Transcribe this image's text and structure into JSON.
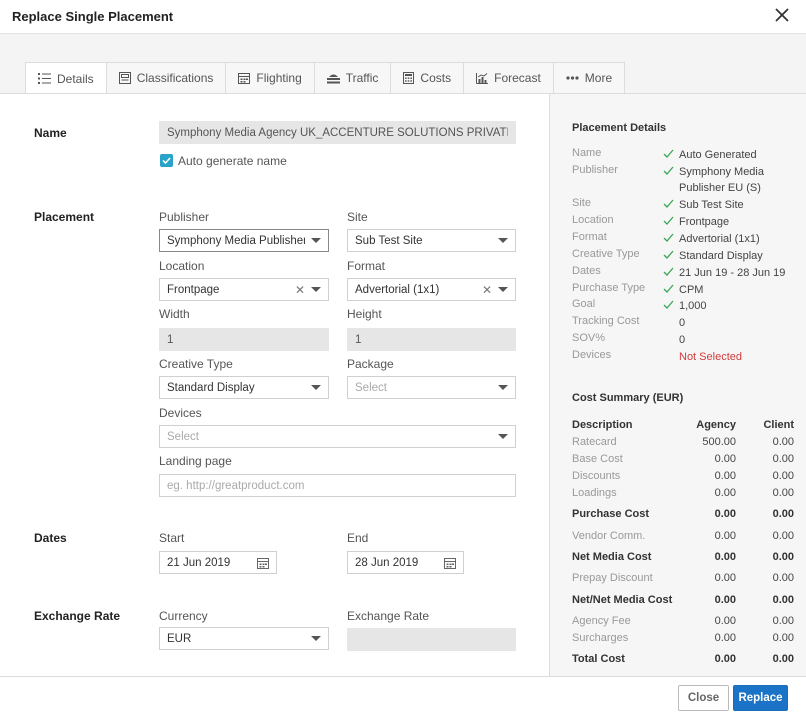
{
  "dialog": {
    "title": "Replace Single Placement"
  },
  "tabs": [
    {
      "label": "Details",
      "icon": "list-icon",
      "active": true
    },
    {
      "label": "Classifications",
      "icon": "classifications-icon"
    },
    {
      "label": "Flighting",
      "icon": "calendar-icon"
    },
    {
      "label": "Traffic",
      "icon": "traffic-icon"
    },
    {
      "label": "Costs",
      "icon": "calculator-icon"
    },
    {
      "label": "Forecast",
      "icon": "forecast-chart-icon"
    },
    {
      "label": "More",
      "icon": "more-dots-icon"
    }
  ],
  "name_section": {
    "label": "Name",
    "value": "Symphony Media Agency UK_ACCENTURE SOLUTIONS PRIVATE LIMITE",
    "auto_generate_label": "Auto generate name",
    "auto_generate_checked": true
  },
  "placement": {
    "label": "Placement",
    "publisher_label": "Publisher",
    "publisher_value": "Symphony Media Publisher EU (S)",
    "site_label": "Site",
    "site_value": "Sub Test Site",
    "location_label": "Location",
    "location_value": "Frontpage",
    "format_label": "Format",
    "format_value": "Advertorial (1x1)",
    "width_label": "Width",
    "width_value": "1",
    "height_label": "Height",
    "height_value": "1",
    "creative_type_label": "Creative Type",
    "creative_type_value": "Standard Display",
    "package_label": "Package",
    "package_placeholder": "Select",
    "devices_label": "Devices",
    "devices_placeholder": "Select",
    "landing_page_label": "Landing page",
    "landing_page_placeholder": "eg. http://greatproduct.com"
  },
  "dates": {
    "label": "Dates",
    "start_label": "Start",
    "start_value": "21 Jun 2019",
    "end_label": "End",
    "end_value": "28 Jun 2019"
  },
  "exchange": {
    "label": "Exchange Rate",
    "currency_label": "Currency",
    "currency_value": "EUR",
    "rate_label": "Exchange Rate",
    "rate_value": ""
  },
  "placement_details": {
    "title": "Placement Details",
    "rows": [
      {
        "key": "Name",
        "value": "Auto Generated",
        "tick": true
      },
      {
        "key": "Publisher",
        "value": "Symphony Media Publisher EU (S)",
        "tick": true
      },
      {
        "key": "Site",
        "value": "Sub Test Site",
        "tick": true
      },
      {
        "key": "Location",
        "value": "Frontpage",
        "tick": true
      },
      {
        "key": "Format",
        "value": "Advertorial (1x1)",
        "tick": true
      },
      {
        "key": "Creative Type",
        "value": "Standard Display",
        "tick": true
      },
      {
        "key": "Dates",
        "value": "21 Jun 19 - 28 Jun 19",
        "tick": true
      },
      {
        "key": "Purchase Type",
        "value": "CPM",
        "tick": true
      },
      {
        "key": "Goal",
        "value": "1,000",
        "tick": true
      },
      {
        "key": "Tracking Cost",
        "value": "0",
        "tick": false
      },
      {
        "key": "SOV%",
        "value": "0",
        "tick": false
      },
      {
        "key": "Devices",
        "value": "Not Selected",
        "tick": false,
        "warn": true
      }
    ]
  },
  "cost_summary": {
    "title": "Cost Summary (EUR)",
    "headers": {
      "description": "Description",
      "agency": "Agency",
      "client": "Client"
    },
    "rows": [
      {
        "label": "Ratecard",
        "agency": "500.00",
        "client": "0.00",
        "bold": false
      },
      {
        "label": "Base Cost",
        "agency": "0.00",
        "client": "0.00",
        "bold": false
      },
      {
        "label": "Discounts",
        "agency": "0.00",
        "client": "0.00",
        "bold": false
      },
      {
        "label": "Loadings",
        "agency": "0.00",
        "client": "0.00",
        "bold": false
      },
      {
        "label": "Purchase Cost",
        "agency": "0.00",
        "client": "0.00",
        "bold": true
      },
      {
        "label": "Vendor Comm.",
        "agency": "0.00",
        "client": "0.00",
        "bold": false
      },
      {
        "label": "Net Media Cost",
        "agency": "0.00",
        "client": "0.00",
        "bold": true
      },
      {
        "label": "Prepay Discount",
        "agency": "0.00",
        "client": "0.00",
        "bold": false
      },
      {
        "label": "Net/Net Media Cost",
        "agency": "0.00",
        "client": "0.00",
        "bold": true
      },
      {
        "label": "Agency Fee",
        "agency": "0.00",
        "client": "0.00",
        "bold": false
      },
      {
        "label": "Surcharges",
        "agency": "0.00",
        "client": "0.00",
        "bold": false
      },
      {
        "label": "Total Cost",
        "agency": "0.00",
        "client": "0.00",
        "bold": true
      }
    ]
  },
  "footer": {
    "close_label": "Close",
    "replace_label": "Replace"
  },
  "colors": {
    "primary": "#1a73c6",
    "check": "#29a3c9",
    "tick": "#3aa655",
    "warn": "#d23c3c"
  }
}
